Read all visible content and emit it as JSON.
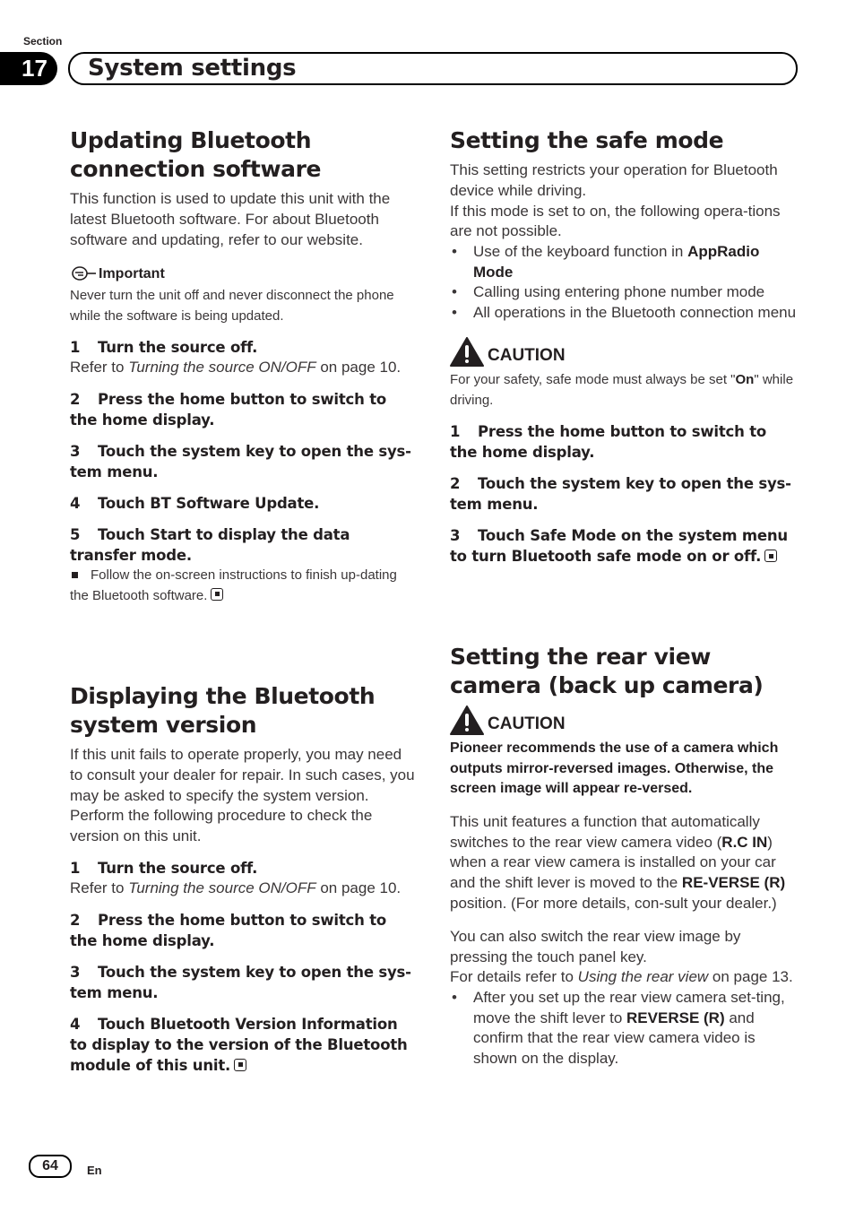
{
  "header": {
    "section_label": "Section",
    "section_number": "17",
    "section_title": "System settings"
  },
  "left": {
    "s1": {
      "title_line1": "Updating Bluetooth",
      "title_line2": "connection software",
      "intro": "This function is used to update this unit with the latest Bluetooth software. For about Bluetooth software and updating, refer to our website.",
      "important_label": "Important",
      "important_text": "Never turn the unit off and never disconnect the phone while the software is being updated.",
      "steps": [
        {
          "n": "1",
          "text": "Turn the source off.",
          "ref_pre": "Refer to ",
          "ref_italic": "Turning the source ON/OFF",
          "ref_post": " on page 10."
        },
        {
          "n": "2",
          "text": "Press the home button to switch to the home display."
        },
        {
          "n": "3",
          "text": "Touch the system key to open the sys-tem menu."
        },
        {
          "n": "4",
          "text": "Touch BT Software Update."
        },
        {
          "n": "5",
          "text": "Touch Start to display the data transfer mode."
        }
      ],
      "note": "Follow the on-screen instructions to finish up-dating the Bluetooth software."
    },
    "s2": {
      "title_line1": "Displaying the Bluetooth",
      "title_line2": "system version",
      "intro": "If this unit fails to operate properly, you may need to consult your dealer for repair. In such cases, you may be asked to specify the system version. Perform the following procedure to check the version on this unit.",
      "steps": [
        {
          "n": "1",
          "text": "Turn the source off.",
          "ref_pre": "Refer to ",
          "ref_italic": "Turning the source ON/OFF",
          "ref_post": " on page 10."
        },
        {
          "n": "2",
          "text": "Press the home button to switch to the home display."
        },
        {
          "n": "3",
          "text": "Touch the system key to open the sys-tem menu."
        },
        {
          "n": "4",
          "text": "Touch Bluetooth Version Information to display to the version of the Bluetooth module of this unit."
        }
      ]
    }
  },
  "right": {
    "s3": {
      "title": "Setting the safe mode",
      "intro1": "This setting restricts your operation for Bluetooth device while driving.",
      "intro2": "If this mode is set to on, the following opera-tions are not possible.",
      "bullets": [
        {
          "pre": "Use of the keyboard function in ",
          "bold": "AppRadio Mode"
        },
        {
          "pre": "Calling using entering phone number mode",
          "bold": ""
        },
        {
          "pre": "All operations in the Bluetooth connection menu",
          "bold": ""
        }
      ],
      "caution_label": "CAUTION",
      "caution_pre": "For your safety, safe mode must always be set \"",
      "caution_bold": "On",
      "caution_post": "\" while driving.",
      "steps": [
        {
          "n": "1",
          "text": "Press the home button to switch to the home display."
        },
        {
          "n": "2",
          "text": "Touch the system key to open the sys-tem menu."
        },
        {
          "n": "3",
          "text": "Touch Safe Mode on the system menu to turn Bluetooth safe mode on or off."
        }
      ]
    },
    "s4": {
      "title_line1": "Setting the rear view",
      "title_line2": "camera (back up camera)",
      "caution_label": "CAUTION",
      "caution_text": "Pioneer recommends the use of a camera which outputs mirror-reversed images. Otherwise, the screen image will appear re-versed.",
      "p1_a": "This unit features a function that automatically switches to the rear view camera video (",
      "p1_b": "R.C IN",
      "p1_c": ") when a rear view camera is installed on your car and the shift lever is moved to the ",
      "p1_d": "RE-VERSE (R)",
      "p1_e": "  position. (For more details, con-sult your dealer.)",
      "p2": "You can also switch the rear view image by pressing the touch panel key.",
      "p3_pre": "For details refer to ",
      "p3_italic": "Using the rear view",
      "p3_post": " on page 13.",
      "bullet_pre": "After you set up the rear view camera set-ting, move the shift lever to ",
      "bullet_bold": "REVERSE (R)",
      "bullet_post": " and confirm that the rear view camera video is shown on the display."
    }
  },
  "footer": {
    "page_number": "64",
    "language": "En"
  }
}
